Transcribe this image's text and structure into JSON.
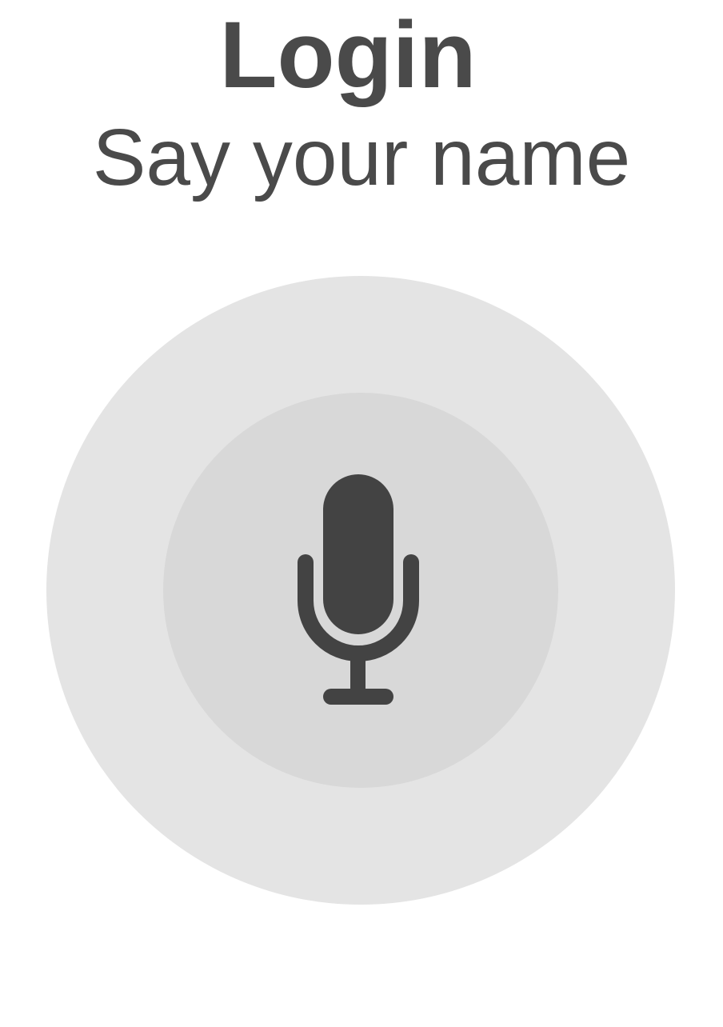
{
  "header": {
    "title": "Login",
    "subtitle": "Say your name"
  },
  "voice_button": {
    "icon": "microphone-icon"
  },
  "colors": {
    "text": "#4a4a4a",
    "outer_ring": "#e4e4e4",
    "inner_ring": "#d8d8d8",
    "icon": "#434343",
    "background": "#ffffff"
  }
}
